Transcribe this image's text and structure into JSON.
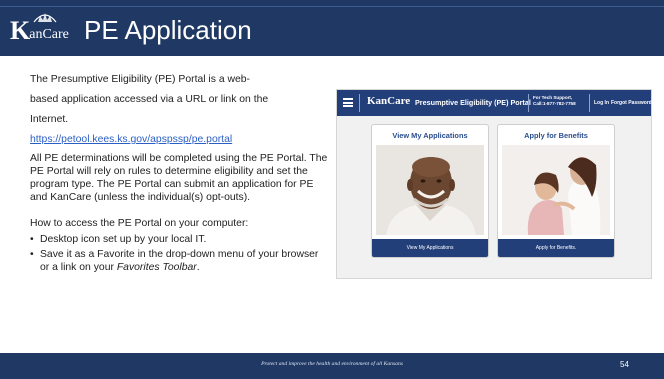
{
  "slide": {
    "logo_text": "KanCare",
    "title": "PE Application"
  },
  "content": {
    "intro_lines": [
      "The Presumptive Eligibility (PE) Portal is a web-",
      "based application accessed via a URL or link on the",
      "Internet."
    ],
    "link": "https://petool.kees.ks.gov/apspssp/pe.portal",
    "paragraph": "All PE determinations will be completed using the PE Portal. The PE Portal will rely on rules to determine eligibility and set the program type. The PE Portal can submit an application for PE and KanCare (unless the individual(s) opt-outs).",
    "access_heading": "How to access the PE Portal on your computer:",
    "bullet_char": "•",
    "bullet1": "Desktop icon set up by your local IT.",
    "bullet2_prefix": "Save it as a Favorite in the drop-down menu of your browser or a link on your ",
    "bullet2_italic": "Favorites Toolbar",
    "bullet2_suffix": "."
  },
  "portal": {
    "logo_text": "KanCare",
    "title": "Presumptive Eligibility (PE) Portal",
    "support_line1": "For Tech Support,",
    "support_line2": "Call:1-877-782-7758",
    "login": "Log In",
    "forgot_password": "Forgot Password",
    "cards": [
      {
        "title": "View My Applications",
        "button": "View My Applications"
      },
      {
        "title": "Apply for Benefits",
        "button": "Apply for Benefits."
      }
    ]
  },
  "footer": {
    "tagline": "Protect and improve the health and environment of all Kansans",
    "page_number": "54"
  },
  "colors": {
    "navy": "#1f3864",
    "portal_navy": "#233f7a",
    "link_blue": "#2b5fc4"
  }
}
